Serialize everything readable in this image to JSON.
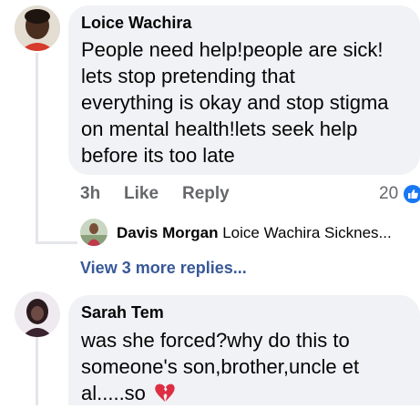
{
  "comments": [
    {
      "author": "Loice Wachira",
      "text_lines": [
        "People need help!people are sick!",
        "lets stop pretending that",
        "everything is okay and stop stigma",
        "on mental health!lets seek help",
        "before its too late"
      ],
      "time": "3h",
      "like_label": "Like",
      "reply_label": "Reply",
      "reaction_count": "20",
      "reaction_icon": "like-icon",
      "reply_preview": {
        "author": "Davis Morgan",
        "snippet": "Loice Wachira Sicknes..."
      },
      "view_more": "View 3 more replies..."
    },
    {
      "author": "Sarah Tem",
      "text_lines": [
        "was she forced?why do this to",
        "someone's son,brother,uncle et",
        "al.....so"
      ],
      "emoji_icon": "broken-heart-icon"
    }
  ],
  "colors": {
    "bubble": "#f0f2f5",
    "secondary_text": "#65676b",
    "like_blue": "#1877f2",
    "link": "#385898",
    "broken_heart": "#dd2e44"
  }
}
